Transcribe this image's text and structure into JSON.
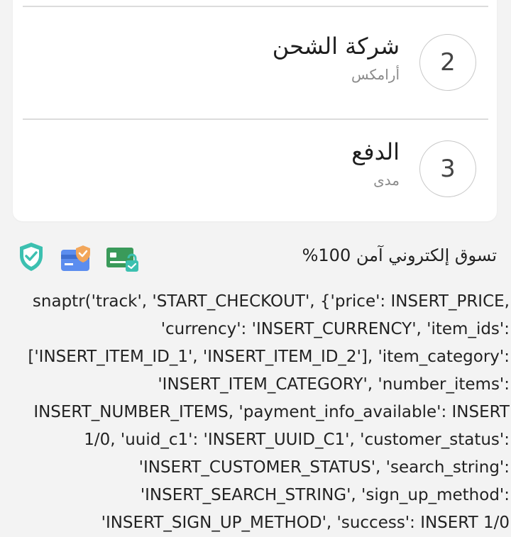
{
  "steps": [
    {
      "number": "2",
      "title": "شركة الشحن",
      "subtitle": "أرامكس"
    },
    {
      "number": "3",
      "title": "الدفع",
      "subtitle": "مدى"
    }
  ],
  "secure_banner": {
    "text": "تسوق إلكتروني آمن 100%",
    "icons": [
      "card-lock-icon",
      "card-shield-icon",
      "shield-check-icon"
    ]
  },
  "tracking_code_lines": [
    "snaptr('track', 'START_CHECKOUT', {'price': INSERT_PRICE,",
    "'currency': 'INSERT_CURRENCY', 'item_ids':",
    "['INSERT_ITEM_ID_1', 'INSERT_ITEM_ID_2'], 'item_category':",
    "'INSERT_ITEM_CATEGORY', 'number_items':",
    "INSERT_NUMBER_ITEMS, 'payment_info_available': INSERT",
    "1/0, 'uuid_c1': 'INSERT_UUID_C1', 'customer_status':",
    "'INSERT_CUSTOMER_STATUS', 'search_string':",
    "'INSERT_SEARCH_STRING', 'sign_up_method':",
    "'INSERT_SIGN_UP_METHOD', 'success': INSERT 1/0"
  ],
  "colors": {
    "background": "#f3f3f3",
    "card": "#ffffff",
    "teal": "#3cc0b0",
    "blue": "#5b8def",
    "orange": "#f2a65a",
    "green": "#3a9a5a"
  }
}
